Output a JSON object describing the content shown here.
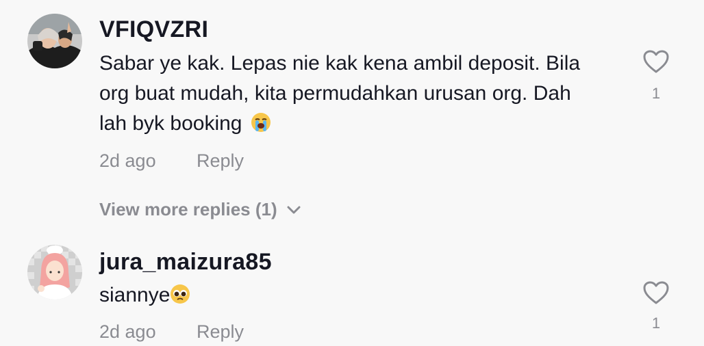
{
  "comments": [
    {
      "username": "VFIQVZRI",
      "text_lines": [
        "Sabar ye kak. Lepas nie kak kena ambil deposit. Bila",
        "org buat mudah, kita permudahkan urusan org. Dah",
        "lah byk booking"
      ],
      "emoji": "loudly-crying-face",
      "time": "2d ago",
      "reply_label": "Reply",
      "like_count": "1",
      "view_more": "View more replies (1)"
    },
    {
      "username": "jura_maizura85",
      "text": "siannye",
      "emoji": "pleading-face",
      "time": "2d ago",
      "reply_label": "Reply",
      "like_count": "1"
    }
  ]
}
